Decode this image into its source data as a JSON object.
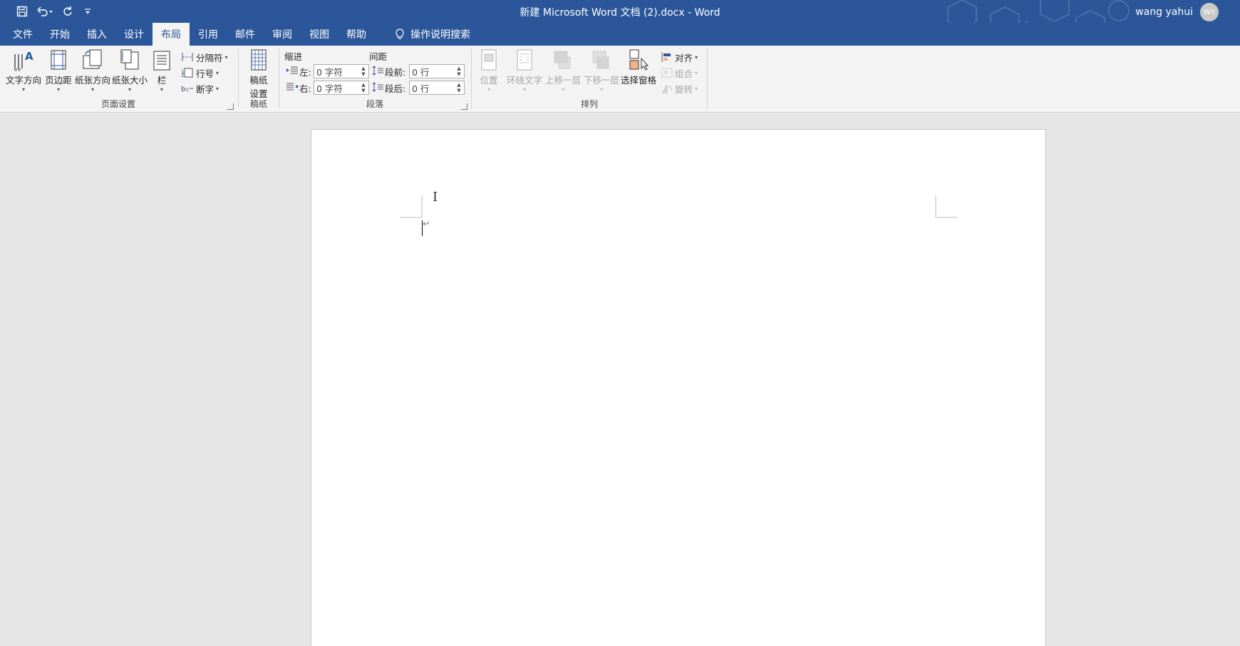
{
  "window": {
    "title": "新建 Microsoft Word 文档 (2).docx  -  Word",
    "user_name": "wang yahui",
    "user_initials": "WY"
  },
  "quick_access": {
    "save_icon": "save-icon",
    "undo_icon": "undo-icon",
    "redo_icon": "redo-icon",
    "customize_icon": "customize-qat-icon"
  },
  "tabs": [
    {
      "label": "文件"
    },
    {
      "label": "开始"
    },
    {
      "label": "插入"
    },
    {
      "label": "设计"
    },
    {
      "label": "布局",
      "active": true
    },
    {
      "label": "引用"
    },
    {
      "label": "邮件"
    },
    {
      "label": "审阅"
    },
    {
      "label": "视图"
    },
    {
      "label": "帮助"
    }
  ],
  "tell_me": {
    "label": "操作说明搜索",
    "icon": "lightbulb-icon"
  },
  "ribbon": {
    "page_setup": {
      "label": "页面设置",
      "text_direction": "文字方向",
      "margins": "页边距",
      "orientation": "纸张方向",
      "size": "纸张大小",
      "columns": "栏",
      "breaks": "分隔符",
      "line_numbers": "行号",
      "hyphenation": "断字"
    },
    "manuscript": {
      "label": "稿纸",
      "button_line1": "稿纸",
      "button_line2": "设置"
    },
    "paragraph": {
      "label": "段落",
      "indent_label": "缩进",
      "spacing_label": "间距",
      "left_label": "左:",
      "right_label": "右:",
      "before_label": "段前:",
      "after_label": "段后:",
      "left_value": "0 字符",
      "right_value": "0 字符",
      "before_value": "0 行",
      "after_value": "0 行"
    },
    "arrange": {
      "label": "排列",
      "position": "位置",
      "wrap_text": "环绕文字",
      "bring_forward": "上移一层",
      "send_backward": "下移一层",
      "selection_pane": "选择窗格",
      "align": "对齐",
      "group": "组合",
      "rotate": "旋转"
    }
  },
  "document": {
    "paragraph_mark": "↵"
  }
}
